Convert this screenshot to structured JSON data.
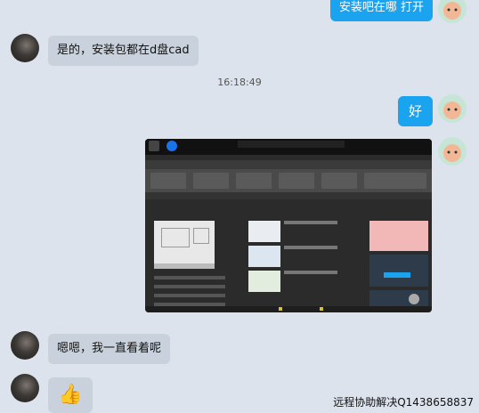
{
  "messages": {
    "m1": "安装吧在哪 打开",
    "m2": "是的，安装包都在d盘cad",
    "timestamp": "16:18:49",
    "m3": "好",
    "m4": "嗯嗯，我一直看着呢",
    "m5_emoji": "👍"
  },
  "screenshot": {
    "panels": {
      "recent_files": "最近使用的文档",
      "samples": [
        "Floor Plan Sample",
        "Data Extraction and Multileaders Sample",
        "Assembly Sample"
      ],
      "start_drawing": "开始绘制"
    }
  },
  "footer": {
    "contact": "远程协助解决Q1438658837"
  }
}
